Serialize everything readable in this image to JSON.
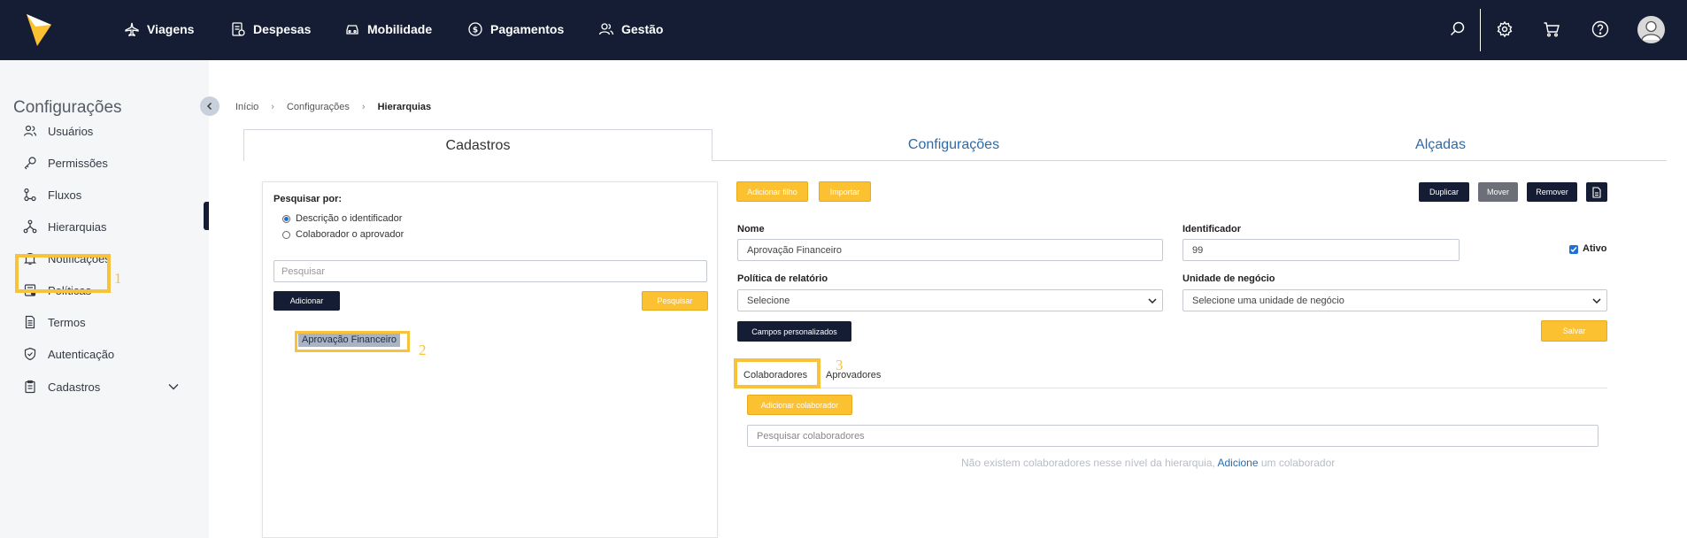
{
  "nav": {
    "items": [
      {
        "label": "Viagens",
        "icon": "plane-icon"
      },
      {
        "label": "Despesas",
        "icon": "receipt-icon"
      },
      {
        "label": "Mobilidade",
        "icon": "car-icon"
      },
      {
        "label": "Pagamentos",
        "icon": "dollar-icon"
      },
      {
        "label": "Gestão",
        "icon": "users-icon"
      }
    ]
  },
  "sidebar": {
    "title": "Configurações",
    "items": [
      {
        "label": "Usuários",
        "icon": "users-icon"
      },
      {
        "label": "Permissões",
        "icon": "key-icon"
      },
      {
        "label": "Fluxos",
        "icon": "flow-icon"
      },
      {
        "label": "Hierarquias",
        "icon": "hierarchy-icon"
      },
      {
        "label": "Notificações",
        "icon": "bell-icon"
      },
      {
        "label": "Políticas",
        "icon": "policy-icon"
      },
      {
        "label": "Termos",
        "icon": "document-icon"
      },
      {
        "label": "Autenticação",
        "icon": "shield-icon"
      },
      {
        "label": "Cadastros",
        "icon": "clipboard-icon"
      }
    ],
    "active": "Hierarquias"
  },
  "annotations": {
    "n1": "1",
    "n2": "2",
    "n3": "3"
  },
  "breadcrumb": {
    "items": [
      "Início",
      "Configurações",
      "Hierarquias"
    ]
  },
  "tabs": [
    {
      "label": "Cadastros"
    },
    {
      "label": "Configurações"
    },
    {
      "label": "Alçadas"
    }
  ],
  "left_panel": {
    "search_by_label": "Pesquisar por:",
    "radio_options": [
      "Descrição o identificador",
      "Colaborador o aprovador"
    ],
    "search_placeholder": "Pesquisar",
    "add_button": "Adicionar",
    "search_button": "Pesquisar",
    "tree_node": "Aprovação Financeiro"
  },
  "right_panel": {
    "add_child_button": "Adicionar filho",
    "import_button": "Importar",
    "duplicate_button": "Duplicar",
    "move_button": "Mover",
    "remove_button": "Remover",
    "name_label": "Nome",
    "name_value": "Aprovação Financeiro",
    "identifier_label": "Identificador",
    "identifier_value": "99",
    "active_label": "Ativo",
    "active_checked": true,
    "policy_label": "Política de relatório",
    "policy_value": "Selecione",
    "business_unit_label": "Unidade de negócio",
    "business_unit_value": "Selecione uma unidade de negócio",
    "custom_fields_button": "Campos personalizados",
    "save_button": "Salvar",
    "sub_tabs": [
      "Colaboradores",
      "Aprovadores"
    ],
    "add_collaborator_button": "Adicionar colaborador",
    "collaborator_search_placeholder": "Pesquisar colaboradores",
    "empty_msg_before": "Não existem colaboradores nesse nível da hierarquia,",
    "empty_msg_link": "Adicione",
    "empty_msg_after": "um colaborador"
  },
  "colors": {
    "topbar": "#141d33",
    "accent_yellow": "#fbc131",
    "highlight": "#f8c23a",
    "link_blue": "#2e6aa8"
  }
}
